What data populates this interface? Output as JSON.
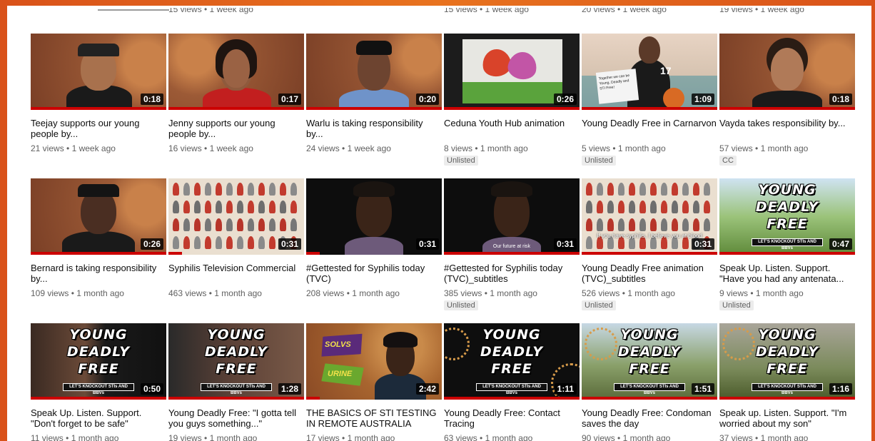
{
  "prev_row_meta": [
    "15 views • 1 week ago",
    "15 views • 1 week ago",
    "20 views • 1 week ago",
    "19 views • 1 week ago"
  ],
  "rows": [
    [
      {
        "title": "Teejay supports our young people by...",
        "views": "21 views",
        "age": "1 week ago",
        "duration": "0:18",
        "badge": "",
        "icon": "person-thumbnail"
      },
      {
        "title": "Jenny supports our young people by...",
        "views": "16 views",
        "age": "1 week ago",
        "duration": "0:17",
        "badge": "",
        "icon": "person-thumbnail"
      },
      {
        "title": "Warlu is taking responsibility by...",
        "views": "24 views",
        "age": "1 week ago",
        "duration": "0:20",
        "badge": "",
        "icon": "person-thumbnail"
      },
      {
        "title": "Ceduna Youth Hub animation",
        "views": "8 views",
        "age": "1 month ago",
        "duration": "0:26",
        "badge": "Unlisted",
        "icon": "animation-thumbnail"
      },
      {
        "title": "Young Deadly Free in Carnarvon",
        "views": "5 views",
        "age": "1 month ago",
        "duration": "1:09",
        "badge": "Unlisted",
        "icon": "basketball-thumbnail",
        "sign_text": "Together we can be Young, Deadly and STI Free!"
      },
      {
        "title": "Vayda takes responsibility by...",
        "views": "57 views",
        "age": "1 month ago",
        "duration": "0:18",
        "badge": "CC",
        "icon": "person-thumbnail"
      }
    ],
    [
      {
        "title": "Bernard is taking responsibility by...",
        "views": "109 views",
        "age": "1 month ago",
        "duration": "0:26",
        "badge": "",
        "icon": "person-thumbnail"
      },
      {
        "title": "Syphilis Television Commercial",
        "views": "463 views",
        "age": "1 month ago",
        "duration": "0:31",
        "badge": "",
        "icon": "figures-thumbnail"
      },
      {
        "title": "#Gettested for Syphilis today (TVC)",
        "views": "208 views",
        "age": "1 month ago",
        "duration": "0:31",
        "badge": "",
        "icon": "person-thumbnail"
      },
      {
        "title": "#Gettested for Syphilis today (TVC)_subtitles",
        "views": "385 views",
        "age": "1 month ago",
        "duration": "0:31",
        "badge": "Unlisted",
        "icon": "person-thumbnail",
        "subtitle": "Our future at risk"
      },
      {
        "title": "Young Deadly Free animation (TVC)_subtitles",
        "views": "526 views",
        "age": "1 month ago",
        "duration": "0:31",
        "badge": "Unlisted",
        "icon": "figures-thumbnail",
        "subtitle": "If you have syphilis, I believe you at blood"
      },
      {
        "title": "Speak Up. Listen. Support. \"Have you had any antenata...",
        "views": "9 views",
        "age": "1 month ago",
        "duration": "0:47",
        "badge": "Unlisted",
        "icon": "ydf-thumbnail"
      }
    ],
    [
      {
        "title": "Speak Up. Listen. Support. \"Don't forget to be safe\"",
        "views": "11 views",
        "age": "1 month ago",
        "duration": "0:50",
        "badge": "",
        "icon": "ydf-thumbnail"
      },
      {
        "title": "Young Deadly Free: \"I gotta tell you guys something...\"",
        "views": "19 views",
        "age": "1 month ago",
        "duration": "1:28",
        "badge": "",
        "icon": "ydf-thumbnail"
      },
      {
        "title": "THE BASICS OF STI TESTING IN REMOTE AUSTRALIA",
        "views": "17 views",
        "age": "1 month ago",
        "duration": "2:42",
        "badge": "",
        "icon": "sti-basics-thumbnail",
        "labels": [
          "SOLVS",
          "URINE"
        ]
      },
      {
        "title": "Young Deadly Free: Contact Tracing",
        "views": "63 views",
        "age": "1 month ago",
        "duration": "1:11",
        "badge": "",
        "icon": "ydf-thumbnail"
      },
      {
        "title": "Young Deadly Free: Condoman saves the day",
        "views": "90 views",
        "age": "1 month ago",
        "duration": "1:51",
        "badge": "",
        "icon": "ydf-thumbnail"
      },
      {
        "title": "Speak up. Listen. Support. \"I'm worried about my son\"",
        "views": "37 views",
        "age": "1 month ago",
        "duration": "1:16",
        "badge": "",
        "icon": "ydf-thumbnail"
      }
    ]
  ],
  "ydf_logo": {
    "lines": [
      "YOUNG",
      "DEADLY",
      "FREE"
    ],
    "banner": "LET'S KNOCKOUT STIs AND BBVs"
  },
  "meta_separator": "•",
  "colors": {
    "progress": "#cc0000",
    "background": "#e8731f",
    "meta": "#606060"
  }
}
